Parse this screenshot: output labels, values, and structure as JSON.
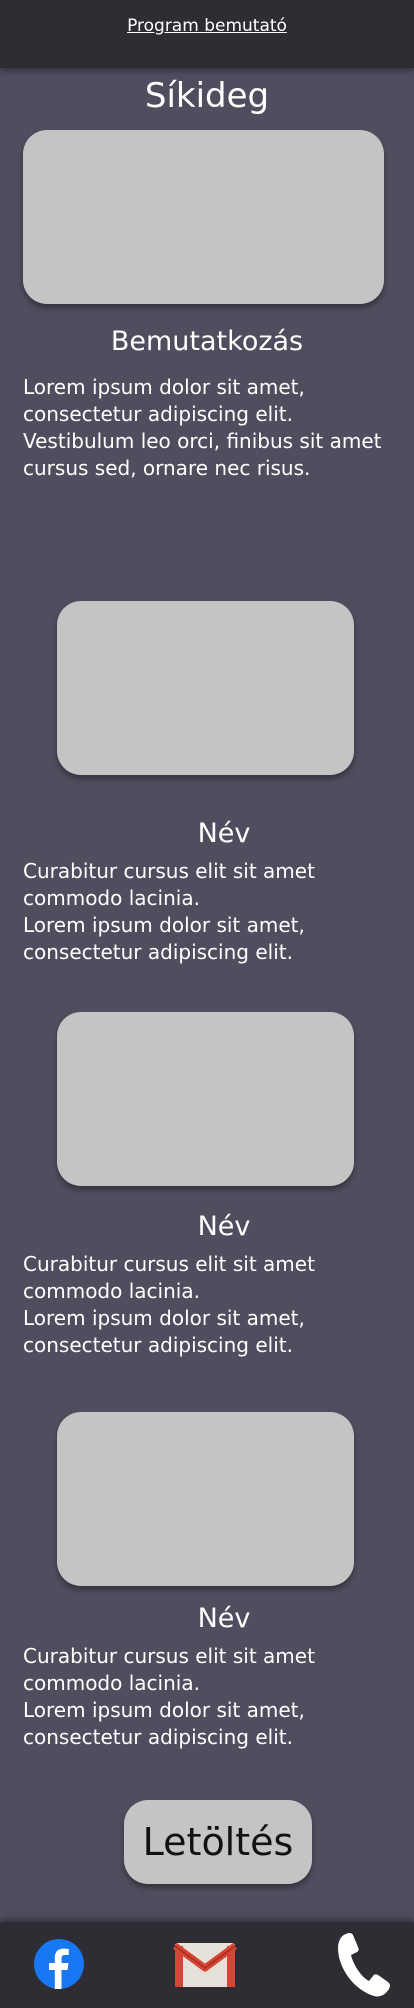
{
  "header": {
    "link_label": "Program bemutató"
  },
  "page_title": "Síkideg",
  "intro": {
    "heading": "Bemutatkozás",
    "text": "Lorem ipsum dolor sit amet, consectetur adipiscing elit. Vestibulum leo orci, finibus sit amet cursus sed, ornare nec risus."
  },
  "members": [
    {
      "name": "Név",
      "text_1": "Curabitur cursus elit sit amet commodo lacinia.",
      "text_2": "Lorem ipsum dolor sit amet, consectetur adipiscing elit."
    },
    {
      "name": "Név",
      "text_1": "Curabitur cursus elit sit amet commodo lacinia.",
      "text_2": "Lorem ipsum dolor sit amet, consectetur adipiscing elit."
    },
    {
      "name": "Név",
      "text_1": "Curabitur cursus elit sit amet commodo lacinia.",
      "text_2": "Lorem ipsum dolor sit amet, consectetur adipiscing elit."
    }
  ],
  "download_button": "Letöltés",
  "footer": {
    "icons": [
      "facebook-icon",
      "gmail-icon",
      "phone-icon"
    ]
  },
  "colors": {
    "background": "#4f4e5f",
    "bar": "#2e2d33",
    "placeholder": "#c4c4c4",
    "facebook": "#1877f2",
    "gmail": "#d44638"
  }
}
